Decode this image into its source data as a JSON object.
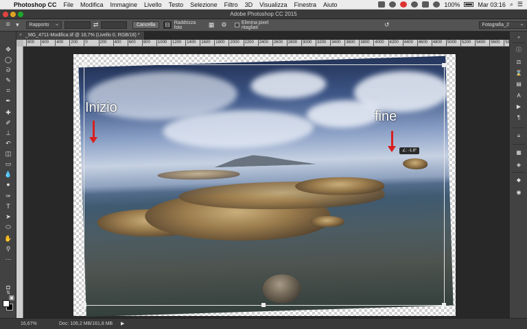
{
  "menubar": {
    "app_name": "Photoshop CC",
    "items": [
      "File",
      "Modifica",
      "Immagine",
      "Livello",
      "Testo",
      "Selezione",
      "Filtro",
      "3D",
      "Visualizza",
      "Finestra",
      "Aiuto"
    ],
    "battery": "100%",
    "clock": "Mar 03:16"
  },
  "window": {
    "title": "Adobe Photoshop CC 2015"
  },
  "options_bar": {
    "ratio_label": "Rapporto",
    "cancel_label": "Cancella",
    "straighten_label": "Raddrizza foto",
    "delete_pixels_label": "Elimina pixel ritagliati",
    "workspace_label": "Fotografia_2"
  },
  "document": {
    "tab_label": "_MG_4711-Modifica.tif @ 16,7% (Livello 0, RGB/16) *"
  },
  "ruler": {
    "labels": [
      "800",
      "600",
      "400",
      "200",
      "0",
      "200",
      "400",
      "600",
      "800",
      "1000",
      "1200",
      "1400",
      "1600",
      "1800",
      "2000",
      "2200",
      "2400",
      "2600",
      "2800",
      "3000",
      "3200",
      "3400",
      "3600",
      "3800",
      "4000",
      "4200",
      "4400",
      "4600",
      "4800",
      "5000",
      "5200",
      "5400",
      "5600",
      "5800"
    ]
  },
  "annotations": {
    "start_label": "Inizio",
    "end_label": "fine",
    "angle": "∠: -1.8°"
  },
  "status": {
    "zoom": "16,67%",
    "doc_info": "Doc: 106,2 MB/161,8 MB"
  },
  "icons": {
    "left_tools": [
      "move-icon",
      "marquee-icon",
      "lasso-icon",
      "quick-select-icon",
      "crop-icon",
      "eyedropper-icon",
      "healing-icon",
      "brush-icon",
      "clone-stamp-icon",
      "history-brush-icon",
      "eraser-icon",
      "gradient-icon",
      "blur-icon",
      "dodge-icon",
      "pen-icon",
      "type-icon",
      "path-select-icon",
      "shape-icon",
      "hand-icon",
      "zoom-icon"
    ],
    "right_panels": [
      "info-icon",
      "adjustments-icon",
      "history-icon",
      "character-icon",
      "actions-icon",
      "paragraph-icon",
      "brushes-icon",
      "channels-icon",
      "layers-icon",
      "paths-icon"
    ]
  },
  "colors": {
    "accent_red": "#d81f1f",
    "ui_dark": "#424242",
    "foreground_swatch": "#ffffff",
    "background_swatch": "#000000"
  }
}
